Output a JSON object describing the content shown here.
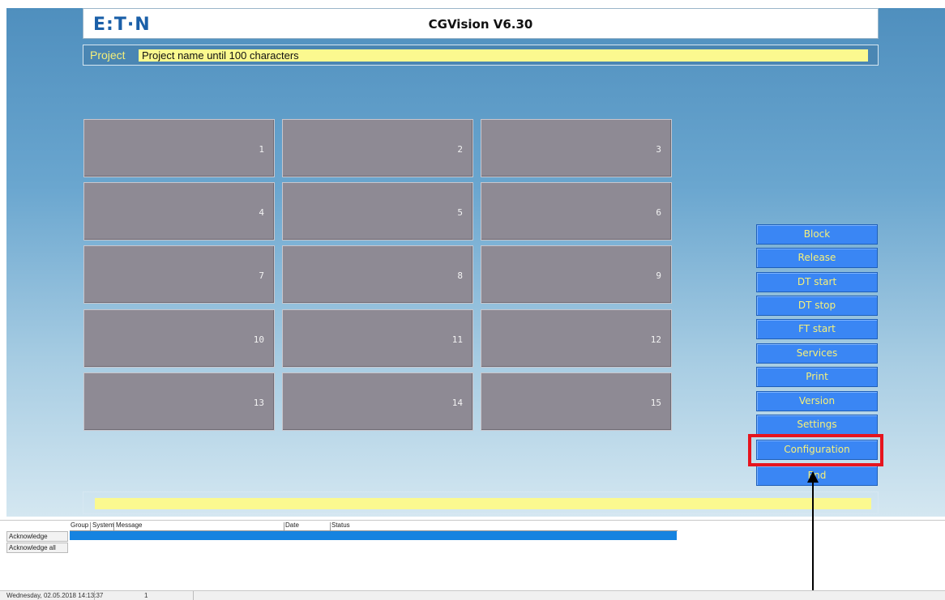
{
  "header": {
    "logo": "E:T·N",
    "title": "CGVision V6.30"
  },
  "project": {
    "label": "Project",
    "value": "Project name until 100 characters"
  },
  "tiles": [
    "1",
    "2",
    "3",
    "4",
    "5",
    "6",
    "7",
    "8",
    "9",
    "10",
    "11",
    "12",
    "13",
    "14",
    "15"
  ],
  "side_buttons": [
    "Block",
    "Release",
    "DT start",
    "DT stop",
    "FT start",
    "Services",
    "Print",
    "Version",
    "Settings",
    "Configuration",
    "End"
  ],
  "alarm": {
    "acknowledge": "Acknowledge",
    "acknowledge_all": "Acknowledge all",
    "columns": [
      "Group",
      "System",
      "Message",
      "Date",
      "Status"
    ]
  },
  "statusbar": {
    "datetime": "Wednesday, 02.05.2018 14:13:37",
    "count": "1"
  },
  "colors": {
    "button_blue": "#3a86f4",
    "button_text": "#f6f07a",
    "highlight": "#e6141e",
    "tile": "#8e8a94",
    "field_yellow": "#fbf98f"
  },
  "annotation": {
    "highlighted_item": "Configuration",
    "arrow_icon": "up-arrow-icon"
  }
}
